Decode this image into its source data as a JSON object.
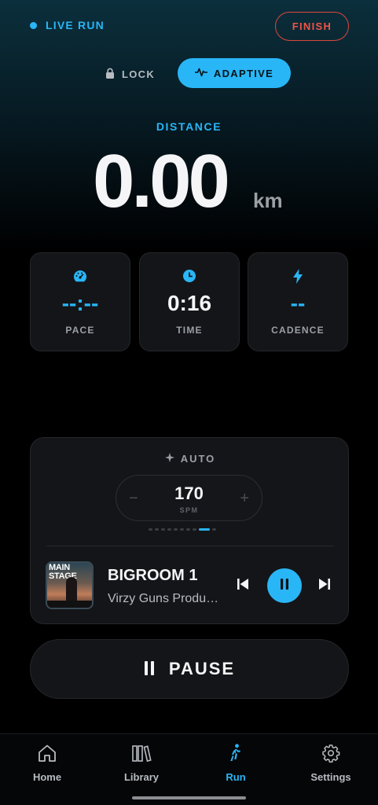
{
  "header": {
    "live_label": "LIVE RUN",
    "finish_label": "FINISH"
  },
  "mode": {
    "lock_label": "LOCK",
    "adaptive_label": "ADAPTIVE",
    "selected": "adaptive"
  },
  "distance": {
    "label": "DISTANCE",
    "value": "0.00",
    "unit": "km"
  },
  "stats": [
    {
      "label": "PACE",
      "value": "--:--",
      "icon": "speedometer-icon"
    },
    {
      "label": "TIME",
      "value": "0:16",
      "icon": "clock-icon"
    },
    {
      "label": "CADENCE",
      "value": "--",
      "icon": "lightning-icon"
    }
  ],
  "cadence_control": {
    "mode_label": "AUTO",
    "value": "170",
    "unit": "SPM",
    "minus": "−",
    "plus": "+",
    "page_count": 10,
    "active_page": 8
  },
  "now_playing": {
    "album_art_text": "MAIN STAGE",
    "title": "BIGROOM 1",
    "artist": "Virzy Guns Productions"
  },
  "pause_label": "PAUSE",
  "nav": {
    "items": [
      {
        "label": "Home",
        "icon": "home-icon"
      },
      {
        "label": "Library",
        "icon": "library-icon"
      },
      {
        "label": "Run",
        "icon": "walker-icon"
      },
      {
        "label": "Settings",
        "icon": "gear-icon"
      }
    ],
    "active": "Run"
  },
  "colors": {
    "accent": "#29b6f6",
    "finish": "#ef5346",
    "card": "#141518",
    "background": "#000000"
  }
}
